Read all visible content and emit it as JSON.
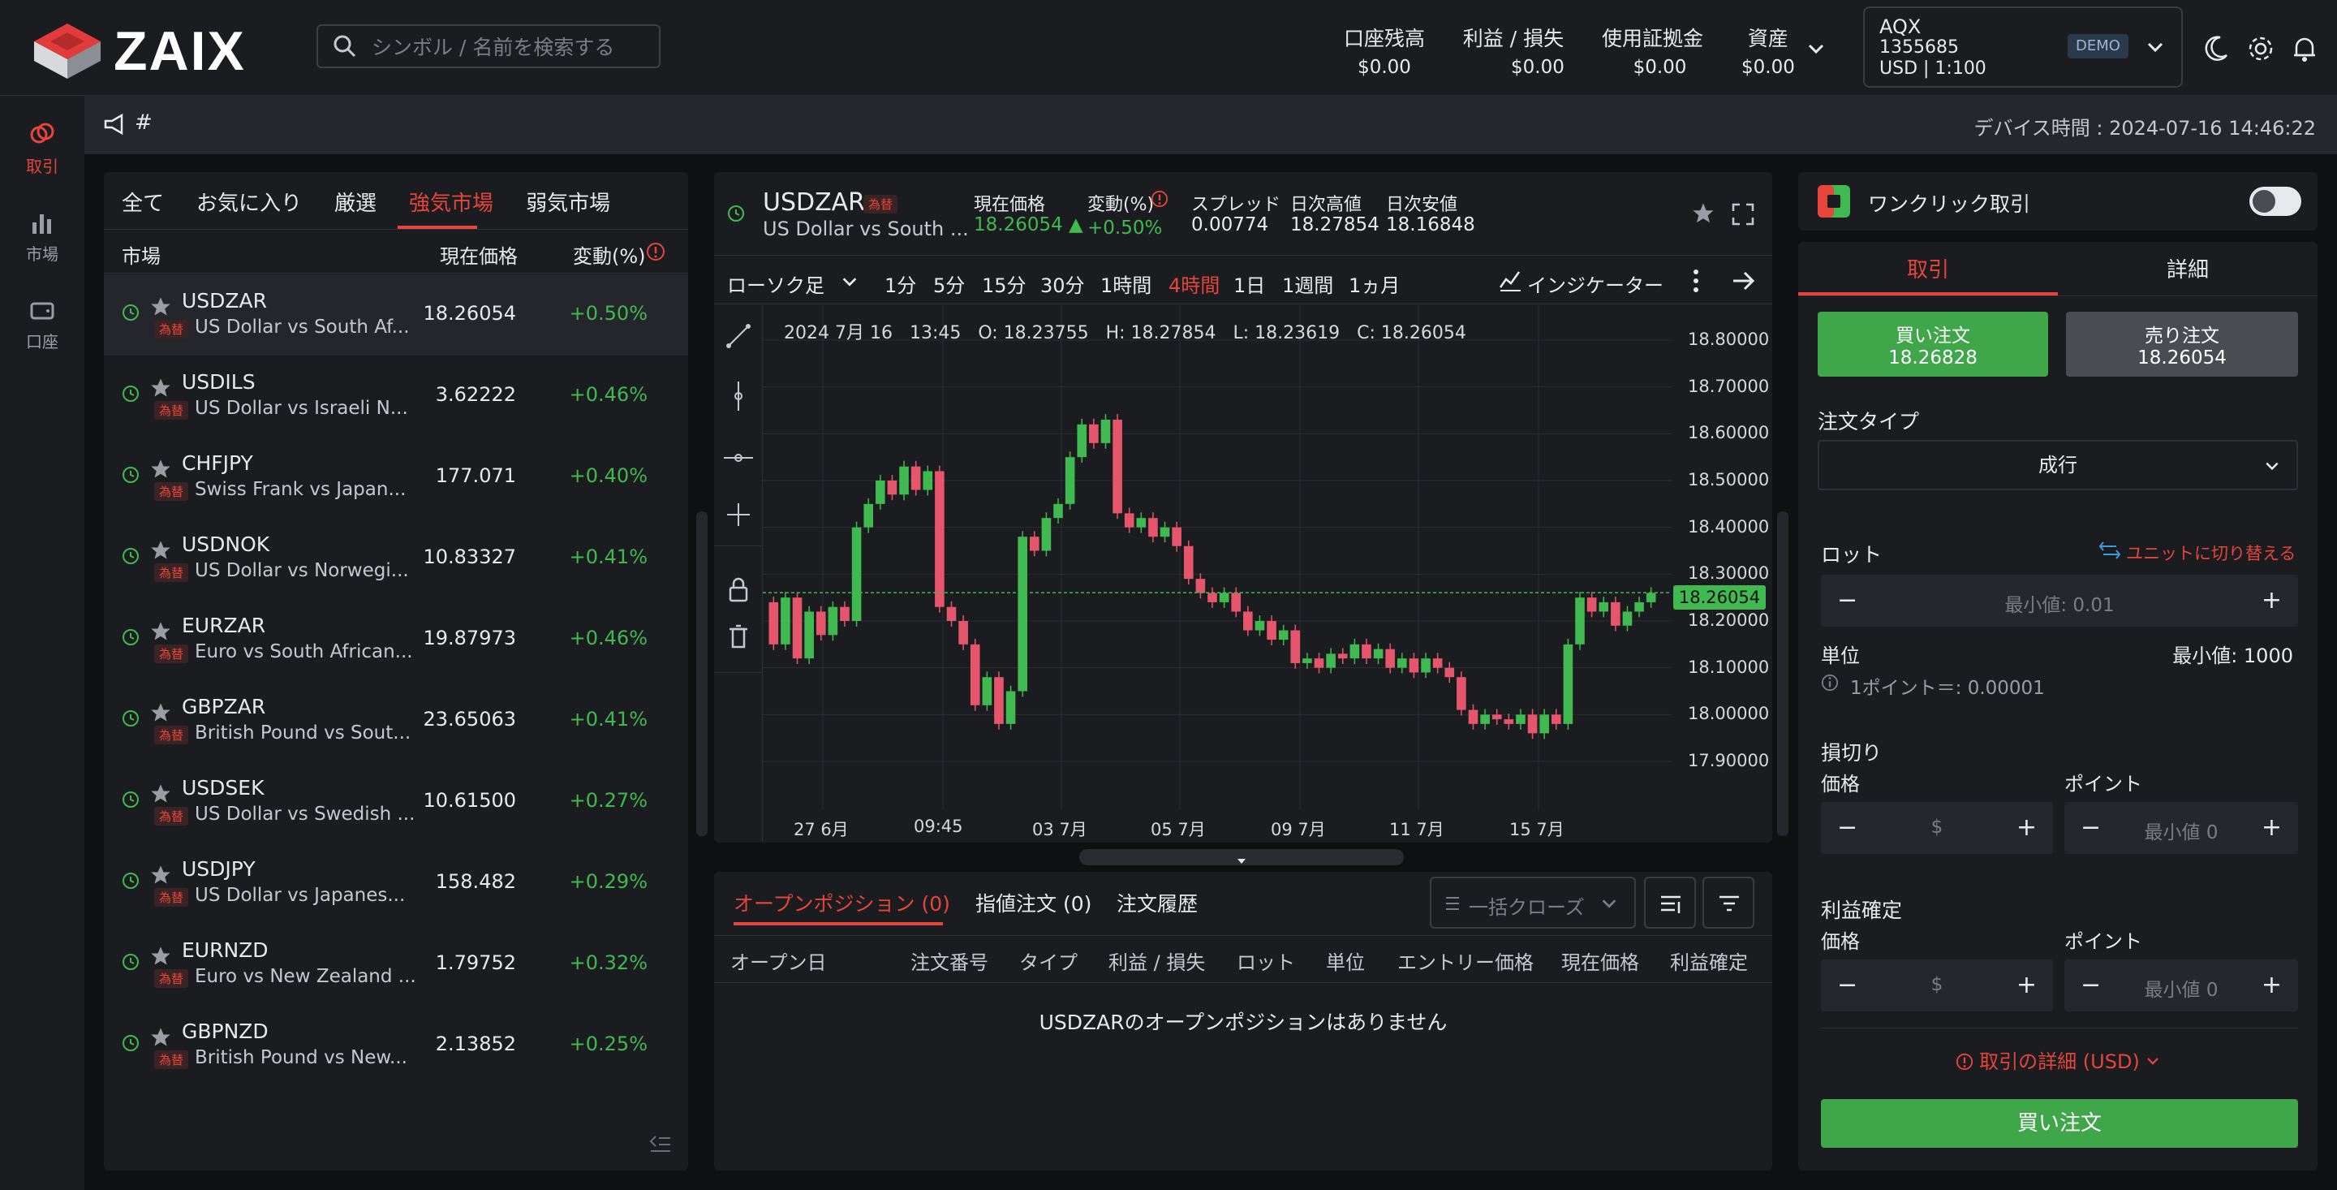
{
  "brand": {
    "name": "ZAIX"
  },
  "search": {
    "placeholder": "シンボル / 名前を検索する"
  },
  "header": {
    "stats": [
      {
        "label": "口座残高",
        "value": "$0.00"
      },
      {
        "label": "利益 / 損失",
        "value": "$0.00"
      },
      {
        "label": "使用証拠金",
        "value": "$0.00"
      },
      {
        "label": "資産",
        "value": "$0.00"
      }
    ],
    "account": {
      "name": "AQX",
      "id": "1355685",
      "leverage": "USD | 1:100",
      "badge": "DEMO"
    }
  },
  "nav": {
    "items": [
      {
        "label": "取引"
      },
      {
        "label": "市場"
      },
      {
        "label": "口座"
      }
    ]
  },
  "subbar": {
    "hash": "#",
    "device_time": "デバイス時間 : 2024-07-16 14:46:22"
  },
  "markets": {
    "tabs": [
      "全て",
      "お気に入り",
      "厳選",
      "強気市場",
      "弱気市場"
    ],
    "active_tab": 3,
    "columns": {
      "market": "市場",
      "price": "現在価格",
      "change": "変動(%)"
    },
    "rows": [
      {
        "symbol": "USDZAR",
        "badge": "為替",
        "desc": "US Dollar vs South Af...",
        "price": "18.26054",
        "change": "+0.50%"
      },
      {
        "symbol": "USDILS",
        "badge": "為替",
        "desc": "US Dollar vs Israeli N...",
        "price": "3.62222",
        "change": "+0.46%"
      },
      {
        "symbol": "CHFJPY",
        "badge": "為替",
        "desc": "Swiss Frank vs Japan...",
        "price": "177.071",
        "change": "+0.40%"
      },
      {
        "symbol": "USDNOK",
        "badge": "為替",
        "desc": "US Dollar vs Norwegi...",
        "price": "10.83327",
        "change": "+0.41%"
      },
      {
        "symbol": "EURZAR",
        "badge": "為替",
        "desc": "Euro vs South African...",
        "price": "19.87973",
        "change": "+0.46%"
      },
      {
        "symbol": "GBPZAR",
        "badge": "為替",
        "desc": "British Pound vs Sout...",
        "price": "23.65063",
        "change": "+0.41%"
      },
      {
        "symbol": "USDSEK",
        "badge": "為替",
        "desc": "US Dollar vs Swedish ...",
        "price": "10.61500",
        "change": "+0.27%"
      },
      {
        "symbol": "USDJPY",
        "badge": "為替",
        "desc": "US Dollar vs Japanes...",
        "price": "158.482",
        "change": "+0.29%"
      },
      {
        "symbol": "EURNZD",
        "badge": "為替",
        "desc": "Euro vs New Zealand ...",
        "price": "1.79752",
        "change": "+0.32%"
      },
      {
        "symbol": "GBPNZD",
        "badge": "為替",
        "desc": "British Pound vs New...",
        "price": "2.13852",
        "change": "+0.25%"
      }
    ]
  },
  "instrument": {
    "symbol": "USDZAR",
    "badge": "為替",
    "desc": "US Dollar vs South ...",
    "stats": [
      {
        "label": "現在価格",
        "value": "18.26054 ▲"
      },
      {
        "label": "変動(%)",
        "value": "+0.50%"
      },
      {
        "label": "スプレッド",
        "value": "0.00774"
      },
      {
        "label": "日次高値",
        "value": "18.27854"
      },
      {
        "label": "日次安値",
        "value": "18.16848"
      }
    ]
  },
  "chart_toolbar": {
    "chart_type": "ローソク足",
    "timeframes": [
      "1分",
      "5分",
      "15分",
      "30分",
      "1時間",
      "4時間",
      "1日",
      "1週間",
      "1ヵ月"
    ],
    "active_timeframe": 5,
    "indicator": "インジケーター"
  },
  "ohlc_legend": "2024 7月 16   13:45   O: 18.23755   H: 18.27854   L: 18.23619   C: 18.26054",
  "chart_data": {
    "type": "candlestick",
    "y_ticks": [
      "18.80000",
      "18.70000",
      "18.60000",
      "18.50000",
      "18.40000",
      "18.30000",
      "18.20000",
      "18.10000",
      "18.00000",
      "17.90000"
    ],
    "ylim": [
      17.87,
      18.85
    ],
    "x_ticks": [
      "27 6月",
      "09:45",
      "03 7月",
      "05 7月",
      "09 7月",
      "11 7月",
      "15 7月"
    ],
    "last_price": "18.26054",
    "last_price_value": 18.26054,
    "candles": [
      [
        18.24,
        18.15
      ],
      [
        18.15,
        18.25
      ],
      [
        18.25,
        18.12
      ],
      [
        18.12,
        18.22
      ],
      [
        18.22,
        18.17
      ],
      [
        18.17,
        18.23
      ],
      [
        18.23,
        18.2
      ],
      [
        18.2,
        18.4
      ],
      [
        18.4,
        18.45
      ],
      [
        18.45,
        18.5
      ],
      [
        18.5,
        18.47
      ],
      [
        18.47,
        18.53
      ],
      [
        18.53,
        18.48
      ],
      [
        18.48,
        18.52
      ],
      [
        18.52,
        18.23
      ],
      [
        18.23,
        18.2
      ],
      [
        18.2,
        18.15
      ],
      [
        18.15,
        18.02
      ],
      [
        18.02,
        18.08
      ],
      [
        18.08,
        17.98
      ],
      [
        17.98,
        18.05
      ],
      [
        18.05,
        18.38
      ],
      [
        18.38,
        18.35
      ],
      [
        18.35,
        18.42
      ],
      [
        18.42,
        18.45
      ],
      [
        18.45,
        18.55
      ],
      [
        18.55,
        18.62
      ],
      [
        18.62,
        18.58
      ],
      [
        18.58,
        18.63
      ],
      [
        18.63,
        18.43
      ],
      [
        18.43,
        18.4
      ],
      [
        18.4,
        18.42
      ],
      [
        18.42,
        18.38
      ],
      [
        18.38,
        18.4
      ],
      [
        18.4,
        18.36
      ],
      [
        18.36,
        18.29
      ],
      [
        18.29,
        18.26
      ],
      [
        18.26,
        18.24
      ],
      [
        18.24,
        18.26
      ],
      [
        18.26,
        18.22
      ],
      [
        18.22,
        18.18
      ],
      [
        18.18,
        18.2
      ],
      [
        18.2,
        18.16
      ],
      [
        18.16,
        18.18
      ],
      [
        18.18,
        18.11
      ],
      [
        18.11,
        18.12
      ],
      [
        18.12,
        18.1
      ],
      [
        18.1,
        18.13
      ],
      [
        18.13,
        18.12
      ],
      [
        18.12,
        18.15
      ],
      [
        18.15,
        18.12
      ],
      [
        18.12,
        18.14
      ],
      [
        18.14,
        18.1
      ],
      [
        18.1,
        18.12
      ],
      [
        18.12,
        18.09
      ],
      [
        18.09,
        18.12
      ],
      [
        18.12,
        18.1
      ],
      [
        18.1,
        18.08
      ],
      [
        18.08,
        18.01
      ],
      [
        18.01,
        17.98
      ],
      [
        17.98,
        18.0
      ],
      [
        18.0,
        17.99
      ],
      [
        17.99,
        17.98
      ],
      [
        17.98,
        18.0
      ],
      [
        18.0,
        17.96
      ],
      [
        17.96,
        18.0
      ],
      [
        18.0,
        17.98
      ],
      [
        17.98,
        18.15
      ],
      [
        18.15,
        18.25
      ],
      [
        18.25,
        18.22
      ],
      [
        18.22,
        18.24
      ],
      [
        18.24,
        18.19
      ],
      [
        18.19,
        18.22
      ],
      [
        18.22,
        18.24
      ],
      [
        18.24,
        18.26
      ]
    ]
  },
  "positions": {
    "tabs": [
      "オープンポジション (0)",
      "指値注文 (0)",
      "注文履歴"
    ],
    "active_tab": 0,
    "bulk_close": "一括クローズ",
    "columns": [
      "オープン日",
      "注文番号",
      "タイプ",
      "利益 / 損失",
      "ロット",
      "単位",
      "エントリー価格",
      "現在価格",
      "利益確定"
    ],
    "empty": "USDZARのオープンポジションはありません"
  },
  "order": {
    "one_click": "ワンクリック取引",
    "tabs": [
      "取引",
      "詳細"
    ],
    "active_tab": 0,
    "buy": {
      "label": "買い注文",
      "price": "18.26828"
    },
    "sell": {
      "label": "売り注文",
      "price": "18.26054"
    },
    "order_type_label": "注文タイプ",
    "order_type": "成行",
    "lot_label": "ロット",
    "unit_switch": "ユニットに切り替える",
    "lot_placeholder": "最小値: 0.01",
    "unit_label": "単位",
    "unit_min": "最小値: 1000",
    "point_info": "1ポイント＝: 0.00001",
    "stop_loss": "損切り",
    "take_profit": "利益確定",
    "price_label": "価格",
    "point_label": "ポイント",
    "price_placeholder": "$",
    "point_placeholder": "最小値 0",
    "details_link": "取引の詳細 (USD)",
    "submit": "買い注文"
  },
  "colors": {
    "accent": "#e5453b",
    "up": "#3fb950",
    "down": "#e5556b",
    "bg": "#1b1c20"
  }
}
